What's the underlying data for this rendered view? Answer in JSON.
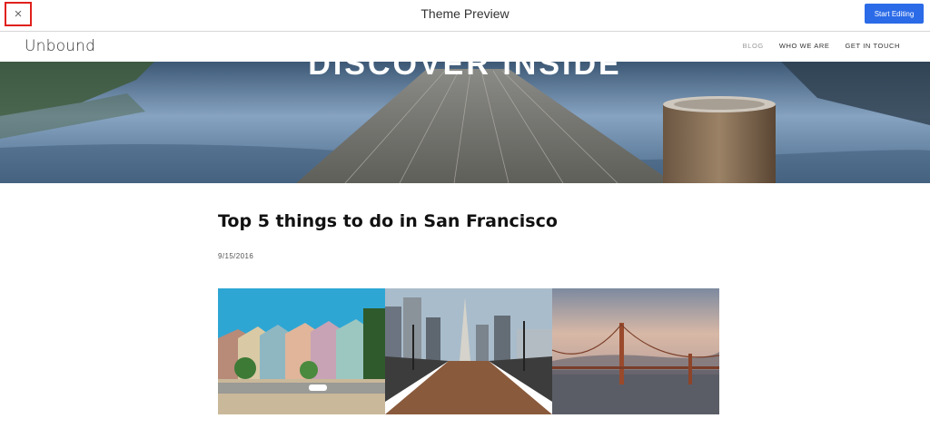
{
  "topbar": {
    "title": "Theme Preview",
    "close_label": "×",
    "start_label": "Start Editing"
  },
  "site": {
    "logo": "Unbound",
    "nav": [
      {
        "label": "BLOG",
        "active": true
      },
      {
        "label": "WHO WE ARE",
        "active": false
      },
      {
        "label": "GET IN TOUCH",
        "active": false
      }
    ]
  },
  "hero": {
    "title": "DISCOVER INSIDE"
  },
  "post": {
    "title": "Top 5 things to do in San Francisco",
    "date": "9/15/2016"
  },
  "gallery": {
    "images": [
      "painted-ladies-photo",
      "pier-city-photo",
      "golden-gate-photo"
    ]
  },
  "colors": {
    "accent": "#2b6be8",
    "highlight": "#e0201c"
  }
}
